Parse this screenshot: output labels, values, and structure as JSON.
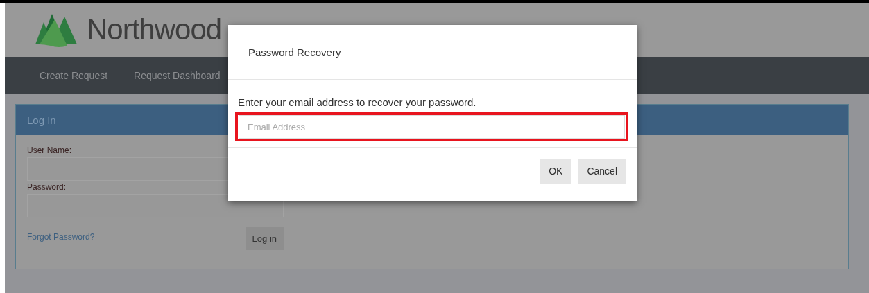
{
  "header": {
    "brand": "Northwood"
  },
  "nav": {
    "items": [
      {
        "label": "Create Request"
      },
      {
        "label": "Request Dashboard"
      }
    ]
  },
  "login_panel": {
    "title": "Log In",
    "fields": [
      {
        "label": "User Name:"
      },
      {
        "label": "Password:"
      }
    ],
    "forgot_link": "Forgot Password?",
    "submit": "Log in"
  },
  "dialog": {
    "title": "Password Recovery",
    "message": "Enter your email address to recover your password.",
    "email": {
      "placeholder": "Email Address",
      "highlighted": true
    },
    "buttons": [
      {
        "label": "OK"
      },
      {
        "label": "Cancel"
      }
    ]
  }
}
